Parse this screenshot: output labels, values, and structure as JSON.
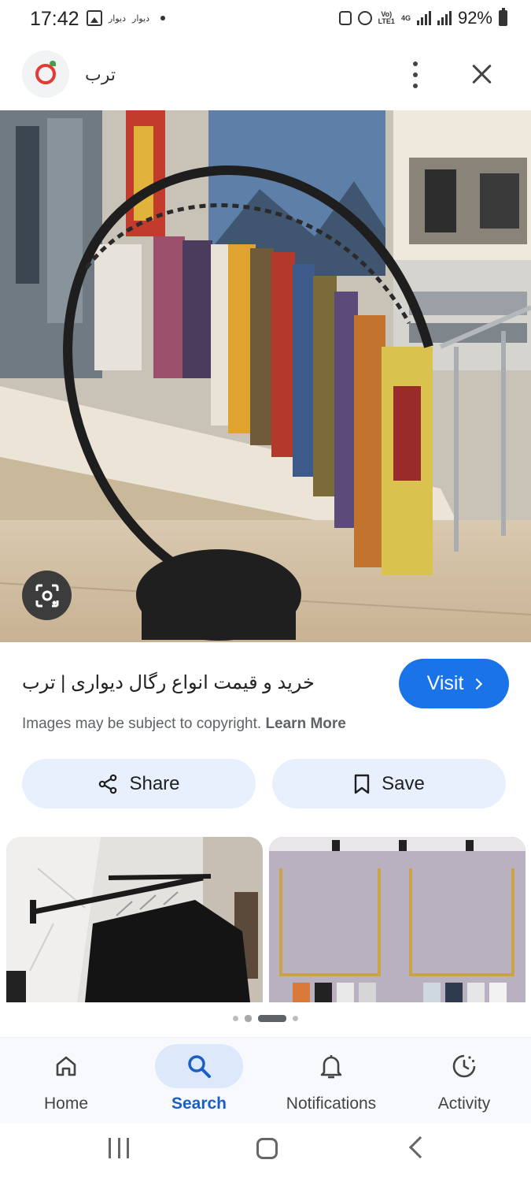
{
  "status_bar": {
    "time": "17:42",
    "notification_text_1": "دیوار",
    "notification_text_2": "دیوار",
    "network_top": "Vo)",
    "network_bottom": "LTE1",
    "network_type": "4G",
    "battery": "92%"
  },
  "header": {
    "site_name": "ترب",
    "logo_icon": "torob-logo-icon",
    "menu_icon": "more-vert-icon",
    "close_icon": "close-icon"
  },
  "main_image": {
    "alt": "Round black metal rack with hanging patterned scarves",
    "lens_icon": "lens-icon"
  },
  "result": {
    "title": "خرید و قیمت انواع رگال دیواری | ترب",
    "visit_label": "Visit",
    "copyright_text": "Images may be subject to copyright.",
    "learn_more": "Learn More"
  },
  "actions": {
    "share_label": "Share",
    "save_label": "Save"
  },
  "related": [
    {
      "alt": "Black wall-mounted clothing rail with black garments"
    },
    {
      "alt": "Gold wall-mounted clothing racks on a lilac wall"
    }
  ],
  "pager": {
    "count": 4,
    "active_index": 2
  },
  "bottom_nav": {
    "items": [
      {
        "label": "Home",
        "icon": "home-icon"
      },
      {
        "label": "Search",
        "icon": "search-icon",
        "active": true
      },
      {
        "label": "Notifications",
        "icon": "bell-icon"
      },
      {
        "label": "Activity",
        "icon": "activity-icon"
      }
    ]
  },
  "colors": {
    "accent": "#1a73e8",
    "tonal_button": "#e8f0fe",
    "active_nav": "#dde8fb"
  }
}
